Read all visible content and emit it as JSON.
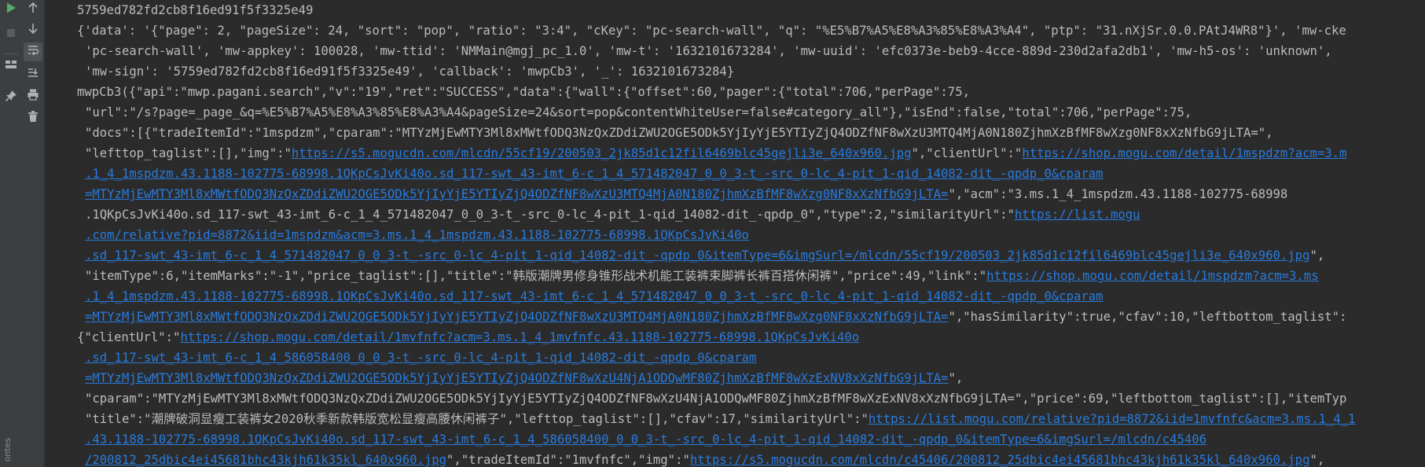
{
  "toolbar": {
    "left": [
      {
        "name": "run-icon",
        "color": "#59a869"
      },
      {
        "name": "stop-icon",
        "color": "#5a5d5f"
      },
      {
        "name": "layout-icon",
        "color": "#afb1b3"
      },
      {
        "name": "pin-icon",
        "color": "#afb1b3"
      }
    ],
    "right": [
      {
        "name": "arrow-up-icon"
      },
      {
        "name": "arrow-down-icon"
      },
      {
        "name": "soft-wrap-icon",
        "active": true
      },
      {
        "name": "scroll-to-end-icon"
      },
      {
        "name": "print-icon"
      },
      {
        "name": "trash-icon"
      }
    ],
    "side_label": "ontes"
  },
  "console": {
    "colors": {
      "text": "#bbbbbb",
      "link": "#287bde",
      "background": "#2b2b2b"
    },
    "lines": [
      {
        "indent": false,
        "segs": [
          {
            "t": "5759ed782fd2cb8f16ed91f5f3325e49"
          }
        ]
      },
      {
        "indent": false,
        "segs": [
          {
            "t": "{'data': '{\"page\": 2, \"pageSize\": 24, \"sort\": \"pop\", \"ratio\": \"3:4\", \"cKey\": \"pc-search-wall\", \"q\": \"%E5%B7%A5%E8%A3%85%E8%A3%A4\", \"ptp\": \"31.nXjSr.0.0.PAtJ4WR8\"}', 'mw-cke"
          }
        ]
      },
      {
        "indent": true,
        "segs": [
          {
            "t": "'pc-search-wall', 'mw-appkey': 100028, 'mw-ttid': 'NMMain@mgj_pc_1.0', 'mw-t': '1632101673284', 'mw-uuid': 'efc0373e-beb9-4cce-889d-230d2afa2db1', 'mw-h5-os': 'unknown',"
          }
        ]
      },
      {
        "indent": true,
        "segs": [
          {
            "t": "'mw-sign': '5759ed782fd2cb8f16ed91f5f3325e49', 'callback': 'mwpCb3', '_': 1632101673284}"
          }
        ]
      },
      {
        "indent": false,
        "segs": [
          {
            "t": "mwpCb3({\"api\":\"mwp.pagani.search\",\"v\":\"19\",\"ret\":\"SUCCESS\",\"data\":{\"wall\":{\"offset\":60,\"pager\":{\"total\":706,\"perPage\":75,"
          }
        ]
      },
      {
        "indent": true,
        "segs": [
          {
            "t": "\"url\":\"/s?page=_page_&q=%E5%B7%A5%E8%A3%85%E8%A3%A4&pageSize=24&sort=pop&contentWhiteUser=false#category_all\"},\"isEnd\":false,\"total\":706,\"perPage\":75,"
          }
        ]
      },
      {
        "indent": true,
        "segs": [
          {
            "t": "\"docs\":[{\"tradeItemId\":\"1mspdzm\",\"cparam\":\"MTYzMjEwMTY3Ml8xMWtfODQ3NzQxZDdiZWU2OGE5ODk5YjIyYjE5YTIyZjQ4ODZfNF8wXzU3MTQ4MjA0N180ZjhmXzBfMF8wXzg0NF8xXzNfbG9jLTA=\","
          }
        ]
      },
      {
        "indent": true,
        "segs": [
          {
            "t": "\"lefttop_taglist\":[],\"img\":\""
          },
          {
            "t": "https://s5.mogucdn.com/mlcdn/55cf19/200503_2jk85d1c12fil6469blc45gejli3e_640x960.jpg",
            "link": true
          },
          {
            "t": "\",\"clientUrl\":\""
          },
          {
            "t": "https://shop.mogu.com/detail/1mspdzm?acm=3.m",
            "link": true
          }
        ]
      },
      {
        "indent": true,
        "segs": [
          {
            "t": ".1_4_1mspdzm.43.1188-102775-68998.1QKpCsJvKi40o.sd_117-swt_43-imt_6-c_1_4_571482047_0_0_3-t_-src_0-lc_4-pit_1-qid_14082-dit_-qpdp_0&cparam",
            "link": true
          }
        ]
      },
      {
        "indent": true,
        "segs": [
          {
            "t": "=MTYzMjEwMTY3Ml8xMWtfODQ3NzQxZDdiZWU2OGE5ODk5YjIyYjE5YTIyZjQ4ODZfNF8wXzU3MTQ4MjA0N180ZjhmXzBfMF8wXzg0NF8xXzNfbG9jLTA=",
            "link": true
          },
          {
            "t": "\",\"acm\":\"3.ms.1_4_1mspdzm.43.1188-102775-68998"
          }
        ]
      },
      {
        "indent": true,
        "segs": [
          {
            "t": ".1QKpCsJvKi40o.sd_117-swt_43-imt_6-c_1_4_571482047_0_0_3-t_-src_0-lc_4-pit_1-qid_14082-dit_-qpdp_0\",\"type\":2,\"similarityUrl\":\""
          },
          {
            "t": "https://list.mogu",
            "link": true
          }
        ]
      },
      {
        "indent": true,
        "segs": [
          {
            "t": ".com/relative?pid=8872&iid=1mspdzm&acm=3.ms.1_4_1mspdzm.43.1188-102775-68998.1QKpCsJvKi40o",
            "link": true
          }
        ]
      },
      {
        "indent": true,
        "segs": [
          {
            "t": ".sd_117-swt_43-imt_6-c_1_4_571482047_0_0_3-t_-src_0-lc_4-pit_1-qid_14082-dit_-qpdp_0&itemType=6&imgSurl=/mlcdn/55cf19/200503_2jk85d1c12fil6469blc45gejli3e_640x960.jpg",
            "link": true
          },
          {
            "t": "\","
          }
        ]
      },
      {
        "indent": true,
        "segs": [
          {
            "t": "\"itemType\":6,\"itemMarks\":\"-1\",\"price_taglist\":[],\"title\":\"韩版潮牌男修身锥形战术机能工装裤束脚裤长裤百搭休闲裤\",\"price\":49,\"link\":\""
          },
          {
            "t": "https://shop.mogu.com/detail/1mspdzm?acm=3.ms",
            "link": true
          }
        ]
      },
      {
        "indent": true,
        "segs": [
          {
            "t": ".1_4_1mspdzm.43.1188-102775-68998.1QKpCsJvKi40o.sd_117-swt_43-imt_6-c_1_4_571482047_0_0_3-t_-src_0-lc_4-pit_1-qid_14082-dit_-qpdp_0&cparam",
            "link": true
          }
        ]
      },
      {
        "indent": true,
        "segs": [
          {
            "t": "=MTYzMjEwMTY3Ml8xMWtfODQ3NzQxZDdiZWU2OGE5ODk5YjIyYjE5YTIyZjQ4ODZfNF8wXzU3MTQ4MjA0N180ZjhmXzBfMF8wXzg0NF8xXzNfbG9jLTA=",
            "link": true
          },
          {
            "t": "\",\"hasSimilarity\":true,\"cfav\":10,\"leftbottom_taglist\":"
          }
        ]
      },
      {
        "indent": false,
        "segs": [
          {
            "t": "{\"clientUrl\":\""
          },
          {
            "t": "https://shop.mogu.com/detail/1mvfnfc?acm=3.ms.1_4_1mvfnfc.43.1188-102775-68998.1QKpCsJvKi40o",
            "link": true
          }
        ]
      },
      {
        "indent": true,
        "segs": [
          {
            "t": ".sd_117-swt_43-imt_6-c_1_4_586058400_0_0_3-t_-src_0-lc_4-pit_1-qid_14082-dit_-qpdp_0&cparam",
            "link": true
          }
        ]
      },
      {
        "indent": true,
        "segs": [
          {
            "t": "=MTYzMjEwMTY3Ml8xMWtfODQ3NzQxZDdiZWU2OGE5ODk5YjIyYjE5YTIyZjQ4ODZfNF8wXzU4NjA1ODQwMF80ZjhmXzBfMF8wXzExNV8xXzNfbG9jLTA=",
            "link": true
          },
          {
            "t": "\","
          }
        ]
      },
      {
        "indent": true,
        "segs": [
          {
            "t": "\"cparam\":\"MTYzMjEwMTY3Ml8xMWtfODQ3NzQxZDdiZWU2OGE5ODk5YjIyYjE5YTIyZjQ4ODZfNF8wXzU4NjA1ODQwMF80ZjhmXzBfMF8wXzExNV8xXzNfbG9jLTA=\",\"price\":69,\"leftbottom_taglist\":[],\"itemTyp"
          }
        ]
      },
      {
        "indent": true,
        "segs": [
          {
            "t": "\"title\":\"潮牌破洞显瘦工装裤女2020秋季新款韩版宽松显瘦高腰休闲裤子\",\"lefttop_taglist\":[],\"cfav\":17,\"similarityUrl\":\""
          },
          {
            "t": "https://list.mogu.com/relative?pid=8872&iid=1mvfnfc&acm=3.ms.1_4_1",
            "link": true
          }
        ]
      },
      {
        "indent": true,
        "segs": [
          {
            "t": ".43.1188-102775-68998.1QKpCsJvKi40o.sd_117-swt_43-imt_6-c_1_4_586058400_0_0_3-t_-src_0-lc_4-pit_1-qid_14082-dit_-qpdp_0&itemType=6&imgSurl=/mlcdn/c45406",
            "link": true
          }
        ]
      },
      {
        "indent": true,
        "segs": [
          {
            "t": "/200812_25dbic4ei45681bhc43kjh61k35kl_640x960.jpg",
            "link": true
          },
          {
            "t": "\",\"tradeItemId\":\"1mvfnfc\",\"img\":\""
          },
          {
            "t": "https://s5.mogucdn.com/mlcdn/c45406/200812_25dbic4ei45681bhc43kjh61k35kl_640x960.jpg",
            "link": true
          },
          {
            "t": "\","
          }
        ]
      }
    ]
  }
}
